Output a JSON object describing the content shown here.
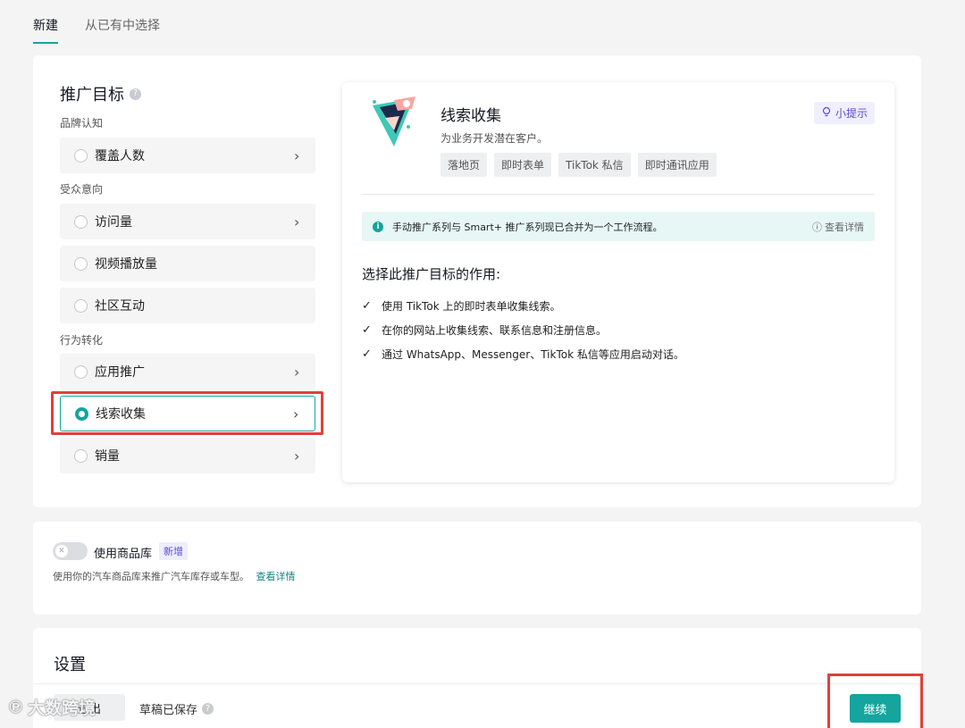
{
  "tabs": [
    {
      "label": "新建",
      "active": true
    },
    {
      "label": "从已有中选择",
      "active": false
    }
  ],
  "goal": {
    "title": "推广目标",
    "groups": [
      {
        "label": "品牌认知",
        "options": [
          "覆盖人数"
        ]
      },
      {
        "label": "受众意向",
        "options": [
          "访问量",
          "视频播放量",
          "社区互动"
        ]
      },
      {
        "label": "行为转化",
        "options": [
          "应用推广",
          "线索收集",
          "销量"
        ]
      }
    ],
    "selected": "线索收集"
  },
  "detail": {
    "name": "线索收集",
    "desc": "为业务开发潜在客户。",
    "tags": [
      "落地页",
      "即时表单",
      "TikTok 私信",
      "即时通讯应用"
    ],
    "tip_label": "小提示",
    "notice": "手动推广系列与 Smart+ 推广系列现已合并为一个工作流程。",
    "notice_more": "查看详情",
    "purpose_title": "选择此推广目标的作用:",
    "purposes": [
      "使用 TikTok 上的即时表单收集线索。",
      "在你的网站上收集线索、联系信息和注册信息。",
      "通过 WhatsApp、Messenger、TikTok 私信等应用启动对话。"
    ]
  },
  "catalog": {
    "label": "使用商品库",
    "badge": "新增",
    "enabled": false,
    "desc": "使用你的汽车商品库来推广汽车库存或车型。",
    "link": "查看详情"
  },
  "settings": {
    "title": "设置"
  },
  "footer": {
    "exit_label": "退出",
    "draft_status": "草稿已保存",
    "continue_label": "继续"
  },
  "watermark": "大数跨境",
  "colors": {
    "accent": "#13a59e",
    "highlight": "#e0403a",
    "tip": "#5b4bd1"
  }
}
